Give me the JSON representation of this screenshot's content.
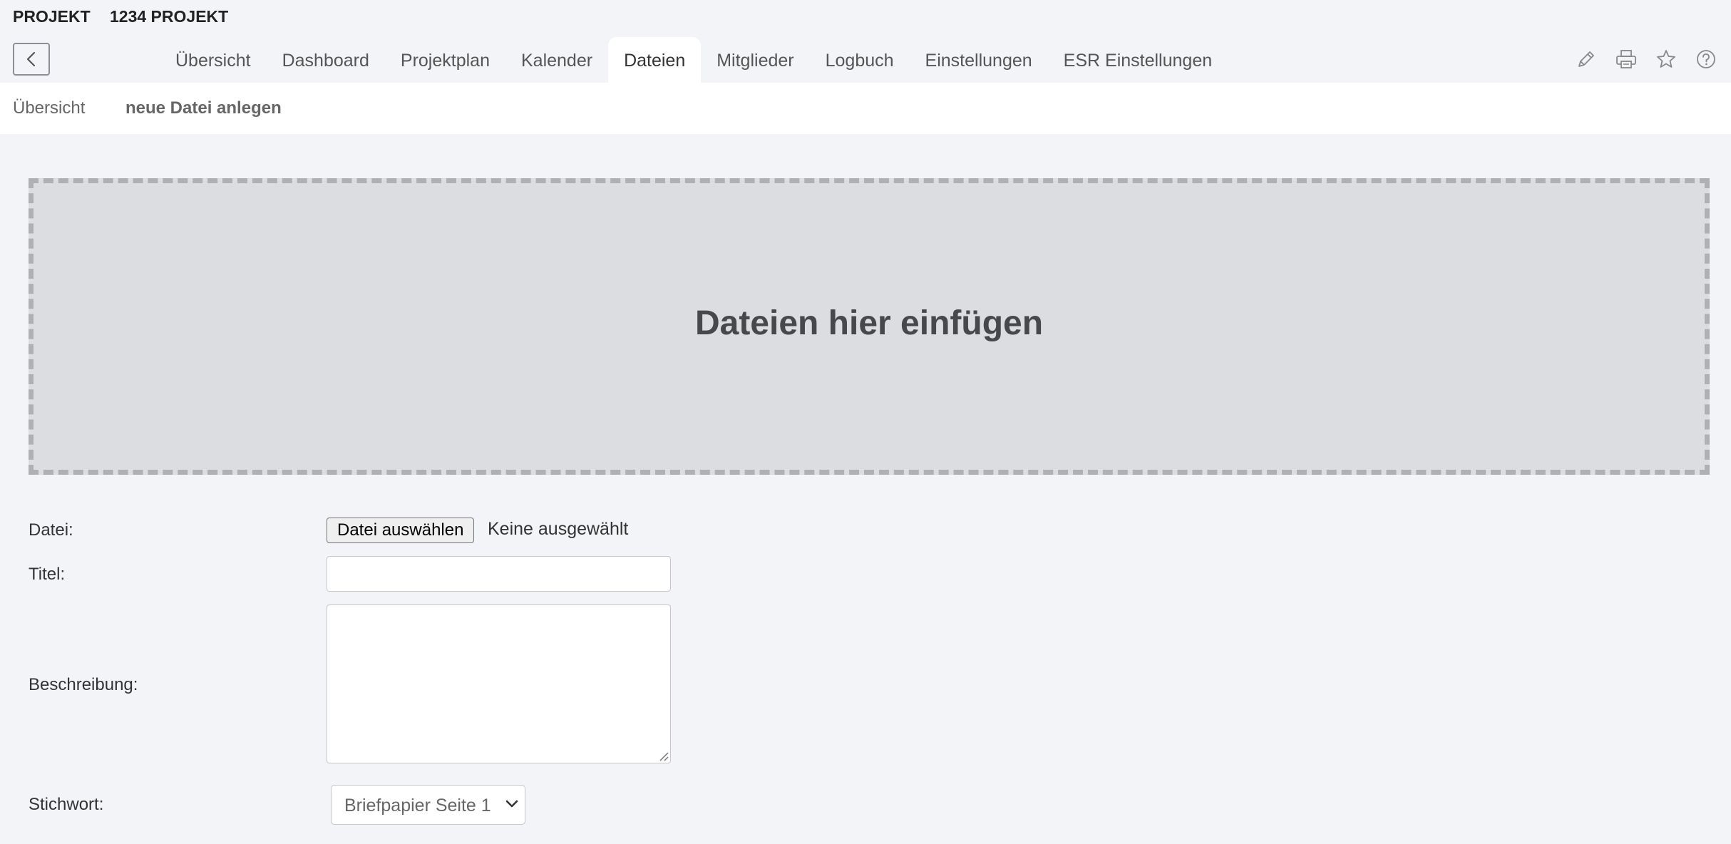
{
  "header": {
    "project_label": "PROJEKT",
    "project_name": "1234 PROJEKT"
  },
  "tabs": [
    {
      "label": "Übersicht"
    },
    {
      "label": "Dashboard"
    },
    {
      "label": "Projektplan"
    },
    {
      "label": "Kalender"
    },
    {
      "label": "Dateien",
      "active": true
    },
    {
      "label": "Mitglieder"
    },
    {
      "label": "Logbuch"
    },
    {
      "label": "Einstellungen"
    },
    {
      "label": "ESR Einstellungen"
    }
  ],
  "toolbar_icons": [
    "pencil-icon",
    "printer-icon",
    "star-icon",
    "help-icon"
  ],
  "subnav": {
    "overview": "Übersicht",
    "new_file": "neue Datei anlegen"
  },
  "dropzone": {
    "text": "Dateien hier einfügen"
  },
  "form": {
    "file_label": "Datei:",
    "file_button": "Datei auswählen",
    "file_status": "Keine ausgewählt",
    "title_label": "Titel:",
    "title_value": "",
    "description_label": "Beschreibung:",
    "description_value": "",
    "keyword_label": "Stichwort:",
    "keyword_value": "Briefpapier Seite 1"
  }
}
